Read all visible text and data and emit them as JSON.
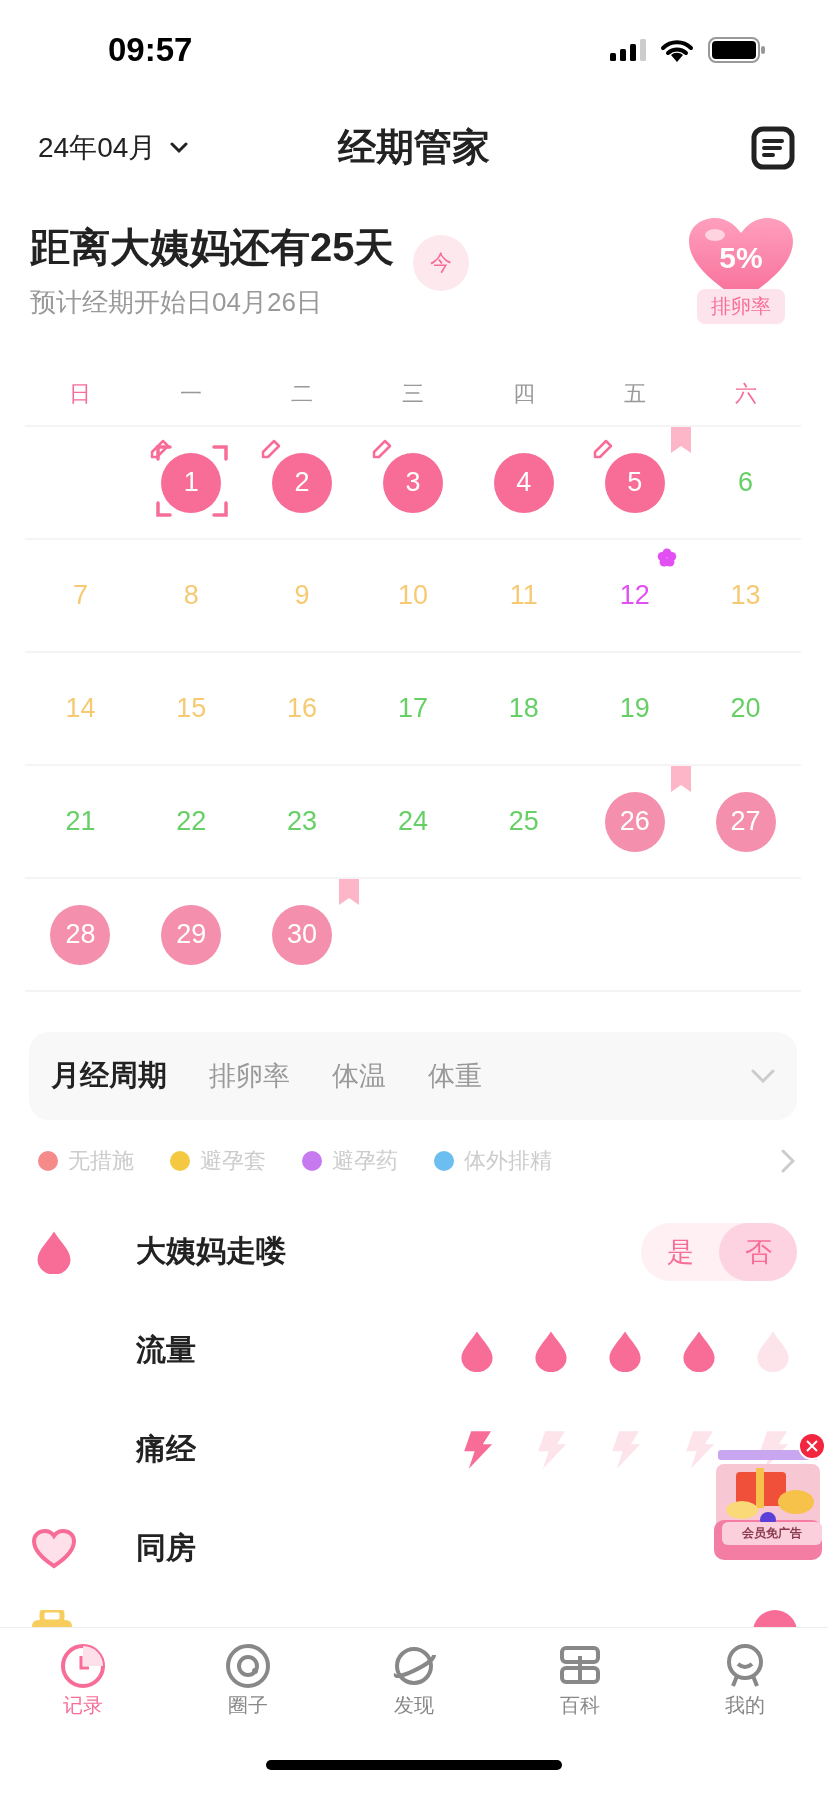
{
  "status_bar": {
    "time": "09:57"
  },
  "header": {
    "month": "24年04月",
    "title": "经期管家"
  },
  "countdown": {
    "title": "距离大姨妈还有25天",
    "subtitle": "预计经期开始日04月26日",
    "today_button": "今",
    "ovulation": {
      "value": "5%",
      "label": "排卵率"
    }
  },
  "weekdays": [
    {
      "label": "日",
      "weekend": true
    },
    {
      "label": "一",
      "weekend": false
    },
    {
      "label": "二",
      "weekend": false
    },
    {
      "label": "三",
      "weekend": false
    },
    {
      "label": "四",
      "weekend": false
    },
    {
      "label": "五",
      "weekend": false
    },
    {
      "label": "六",
      "weekend": true
    }
  ],
  "weeks": [
    [
      {
        "kind": "blank"
      },
      {
        "day": "1",
        "kind": "period",
        "today": true,
        "note": true,
        "bookmark": false,
        "flower": false
      },
      {
        "day": "2",
        "kind": "period",
        "today": false,
        "note": true,
        "bookmark": false,
        "flower": false
      },
      {
        "day": "3",
        "kind": "period",
        "today": false,
        "note": true,
        "bookmark": false,
        "flower": false
      },
      {
        "day": "4",
        "kind": "period",
        "today": false,
        "note": false,
        "bookmark": false,
        "flower": false
      },
      {
        "day": "5",
        "kind": "period",
        "today": false,
        "note": true,
        "bookmark": true,
        "flower": false
      },
      {
        "day": "6",
        "kind": "safe",
        "today": false,
        "note": false,
        "bookmark": false,
        "flower": false
      }
    ],
    [
      {
        "day": "7",
        "kind": "fertile",
        "today": false,
        "note": false,
        "bookmark": false,
        "flower": false
      },
      {
        "day": "8",
        "kind": "fertile",
        "today": false,
        "note": false,
        "bookmark": false,
        "flower": false
      },
      {
        "day": "9",
        "kind": "fertile",
        "today": false,
        "note": false,
        "bookmark": false,
        "flower": false
      },
      {
        "day": "10",
        "kind": "fertile",
        "today": false,
        "note": false,
        "bookmark": false,
        "flower": false
      },
      {
        "day": "11",
        "kind": "fertile",
        "today": false,
        "note": false,
        "bookmark": false,
        "flower": false
      },
      {
        "day": "12",
        "kind": "ovulation",
        "today": false,
        "note": false,
        "bookmark": false,
        "flower": true
      },
      {
        "day": "13",
        "kind": "fertile",
        "today": false,
        "note": false,
        "bookmark": false,
        "flower": false
      }
    ],
    [
      {
        "day": "14",
        "kind": "fertile",
        "today": false,
        "note": false,
        "bookmark": false,
        "flower": false
      },
      {
        "day": "15",
        "kind": "fertile",
        "today": false,
        "note": false,
        "bookmark": false,
        "flower": false
      },
      {
        "day": "16",
        "kind": "fertile",
        "today": false,
        "note": false,
        "bookmark": false,
        "flower": false
      },
      {
        "day": "17",
        "kind": "safe",
        "today": false,
        "note": false,
        "bookmark": false,
        "flower": false
      },
      {
        "day": "18",
        "kind": "safe",
        "today": false,
        "note": false,
        "bookmark": false,
        "flower": false
      },
      {
        "day": "19",
        "kind": "safe",
        "today": false,
        "note": false,
        "bookmark": false,
        "flower": false
      },
      {
        "day": "20",
        "kind": "safe",
        "today": false,
        "note": false,
        "bookmark": false,
        "flower": false
      }
    ],
    [
      {
        "day": "21",
        "kind": "safe",
        "today": false,
        "note": false,
        "bookmark": false,
        "flower": false
      },
      {
        "day": "22",
        "kind": "safe",
        "today": false,
        "note": false,
        "bookmark": false,
        "flower": false
      },
      {
        "day": "23",
        "kind": "safe",
        "today": false,
        "note": false,
        "bookmark": false,
        "flower": false
      },
      {
        "day": "24",
        "kind": "safe",
        "today": false,
        "note": false,
        "bookmark": false,
        "flower": false
      },
      {
        "day": "25",
        "kind": "safe",
        "today": false,
        "note": false,
        "bookmark": false,
        "flower": false
      },
      {
        "day": "26",
        "kind": "predicted",
        "today": false,
        "note": false,
        "bookmark": true,
        "flower": false
      },
      {
        "day": "27",
        "kind": "predicted",
        "today": false,
        "note": false,
        "bookmark": false,
        "flower": false
      }
    ],
    [
      {
        "day": "28",
        "kind": "predicted",
        "today": false,
        "note": false,
        "bookmark": false,
        "flower": false
      },
      {
        "day": "29",
        "kind": "predicted",
        "today": false,
        "note": false,
        "bookmark": false,
        "flower": false
      },
      {
        "day": "30",
        "kind": "predicted",
        "today": false,
        "note": false,
        "bookmark": true,
        "flower": false
      },
      {
        "kind": "blank"
      },
      {
        "kind": "blank"
      },
      {
        "kind": "blank"
      },
      {
        "kind": "blank"
      }
    ]
  ],
  "chart_tabs": [
    {
      "label": "月经周期",
      "selected": true
    },
    {
      "label": "排卵率",
      "selected": false
    },
    {
      "label": "体温",
      "selected": false
    },
    {
      "label": "体重",
      "selected": false
    }
  ],
  "legend": [
    {
      "label": "无措施",
      "color": "#f58a8a"
    },
    {
      "label": "避孕套",
      "color": "#f5c842"
    },
    {
      "label": "避孕药",
      "color": "#c77af0"
    },
    {
      "label": "体外排精",
      "color": "#6cbdf0"
    }
  ],
  "records": [
    {
      "kind": "toggle",
      "label": "大姨妈走喽",
      "options": [
        {
          "label": "是",
          "selected": false
        },
        {
          "label": "否",
          "selected": true
        }
      ]
    },
    {
      "kind": "drops",
      "label": "流量",
      "stars": 4
    },
    {
      "kind": "bolts",
      "label": "痛经",
      "stars": 1
    },
    {
      "kind": "plain",
      "label": "同房"
    }
  ],
  "ad": {
    "button": "会员免广告"
  },
  "tab_bar": [
    {
      "label": "记录",
      "selected": true
    },
    {
      "label": "圈子",
      "selected": false
    },
    {
      "label": "发现",
      "selected": false
    },
    {
      "label": "百科",
      "selected": false
    },
    {
      "label": "我的",
      "selected": false
    }
  ]
}
